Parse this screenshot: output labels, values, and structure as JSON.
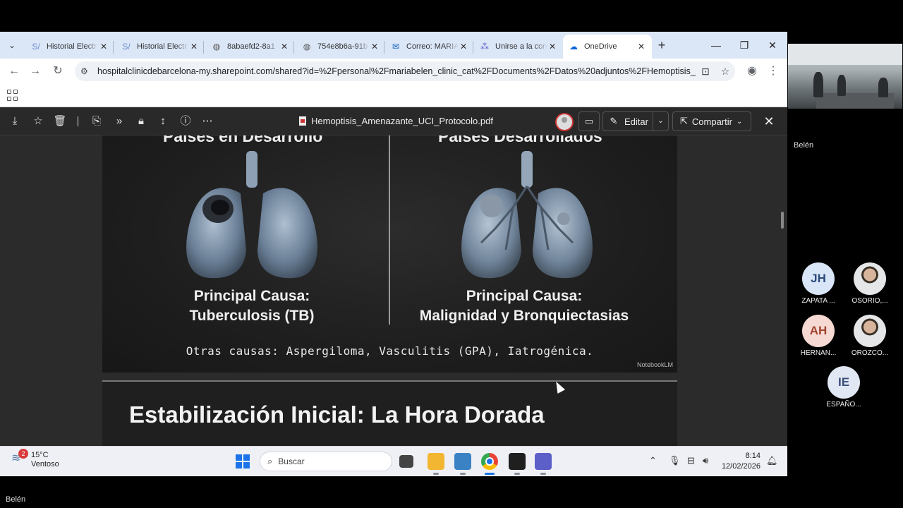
{
  "browser": {
    "tabs": [
      {
        "label": "Historial Electr",
        "icon": "sharepoint-icon",
        "active": false
      },
      {
        "label": "Historial Electr",
        "icon": "sharepoint-icon",
        "active": false
      },
      {
        "label": "8abaefd2-8a1",
        "icon": "globe-icon",
        "active": false
      },
      {
        "label": "754e8b6a-91b",
        "icon": "globe-icon",
        "active": false
      },
      {
        "label": "Correo: MARIA",
        "icon": "outlook-icon",
        "active": false
      },
      {
        "label": "Unirse a la con",
        "icon": "teams-icon",
        "active": false
      },
      {
        "label": "OneDrive",
        "icon": "onedrive-icon",
        "active": true
      }
    ],
    "url": "hospitalclinicdebarcelona-my.sharepoint.com/shared?id=%2Fpersonal%2Fmariabelen_clinic_cat%2FDocuments%2FDatos%20adjuntos%2FHemoptisis_Am..."
  },
  "viewer": {
    "filename": "Hemoptisis_Amenazante_UCI_Protocolo.pdf",
    "edit_label": "Editar",
    "share_label": "Compartir"
  },
  "slide1": {
    "left_header": "Países en Desarrollo",
    "right_header": "Países Desarrollados",
    "left_cause_line1": "Principal Causa:",
    "left_cause_line2": "Tuberculosis (TB)",
    "right_cause_line1": "Principal Causa:",
    "right_cause_line2": "Malignidad y Bronquiectasias",
    "others": "Otras causas: Aspergiloma, Vasculitis (GPA), Iatrogénica.",
    "watermark": "NotebookLM"
  },
  "slide2": {
    "title": "Estabilización Inicial: La Hora Dorada"
  },
  "taskbar": {
    "weather_temp": "15°C",
    "weather_desc": "Ventoso",
    "weather_badge": "2",
    "search_placeholder": "Buscar",
    "time": "8:14",
    "date": "12/02/2026"
  },
  "meeting": {
    "self_name": "Belén",
    "bottom_name": "Belén",
    "participants": [
      {
        "initials": "JH",
        "name": "ZAPATA ...",
        "color": "#d9e6f7",
        "text_color": "#2b4a7a"
      },
      {
        "initials": "",
        "name": "OSORIO,...",
        "color": "photo",
        "text_color": ""
      },
      {
        "initials": "AH",
        "name": "HERNAN...",
        "color": "#f6d9d2",
        "text_color": "#a0422c"
      },
      {
        "initials": "",
        "name": "OROZCO...",
        "color": "photo",
        "text_color": ""
      },
      {
        "initials": "IE",
        "name": "ESPAÑO...",
        "color": "#e1e7f3",
        "text_color": "#3a4f7a"
      }
    ]
  }
}
